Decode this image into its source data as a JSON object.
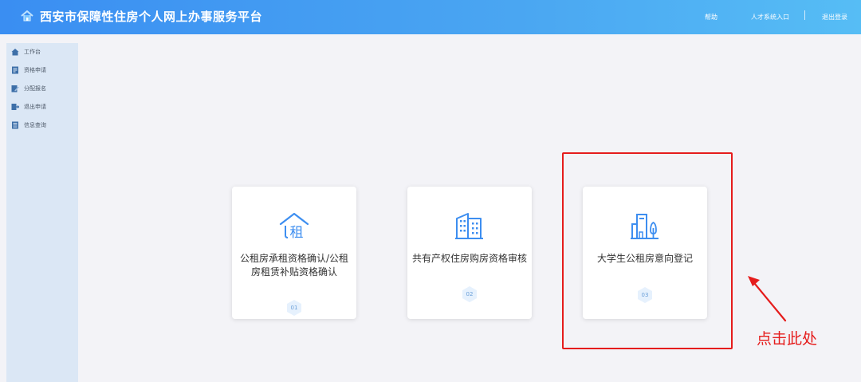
{
  "header": {
    "title": "西安市保障性住房个人网上办事服务平台",
    "logo_icon": "house-icon",
    "links": {
      "help": "帮助",
      "talent_entry": "人才系统入口",
      "logout": "退出登录"
    }
  },
  "sidebar": {
    "items": [
      {
        "label": "工作台",
        "icon": "home-icon"
      },
      {
        "label": "资格申请",
        "icon": "document-icon"
      },
      {
        "label": "分配报名",
        "icon": "edit-icon"
      },
      {
        "label": "退出申请",
        "icon": "exit-icon"
      },
      {
        "label": "信息查询",
        "icon": "list-icon"
      }
    ]
  },
  "cards": [
    {
      "title": "公租房承租资格确认/公租房租赁补贴资格确认",
      "number": "01",
      "icon": "rent-house-icon"
    },
    {
      "title": "共有产权住房购房资格审核",
      "number": "02",
      "icon": "building-icon"
    },
    {
      "title": "大学生公租房意向登记",
      "number": "03",
      "icon": "building-tree-icon"
    }
  ],
  "annotation": {
    "text": "点击此处",
    "color": "#e51c1c"
  },
  "colors": {
    "header_start": "#3a8ef2",
    "header_end": "#56bdf5",
    "accent": "#3d8ef0",
    "sidebar_bg": "#dbe7f5",
    "page_bg": "#f3f3f7"
  }
}
